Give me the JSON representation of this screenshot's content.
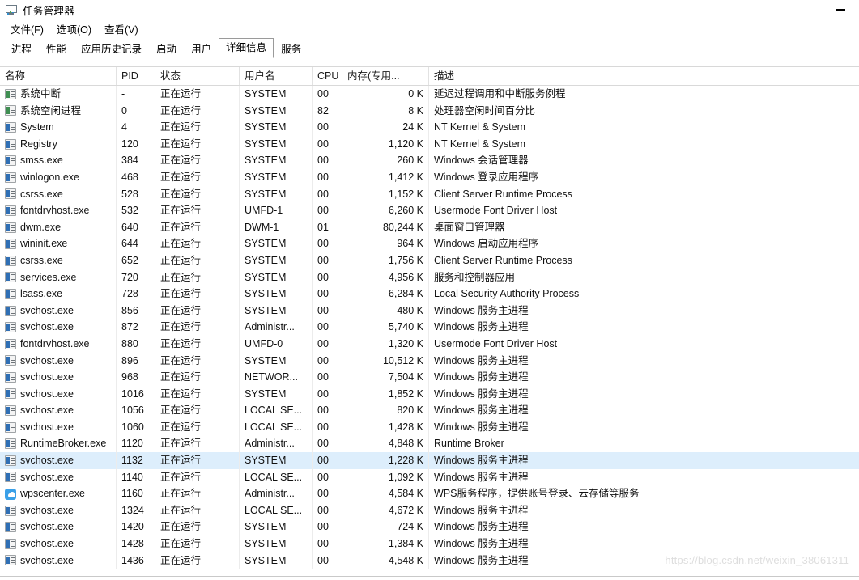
{
  "window": {
    "title": "任务管理器",
    "icon": "task-manager-icon",
    "controls": [
      {
        "name": "minimize-button",
        "glyph": "—"
      }
    ]
  },
  "menu": {
    "items": [
      {
        "label": "文件(F)",
        "accel": "F"
      },
      {
        "label": "选项(O)",
        "accel": "O"
      },
      {
        "label": "查看(V)",
        "accel": "V"
      }
    ]
  },
  "tabs": {
    "active": "详细信息",
    "items": [
      {
        "label": "进程"
      },
      {
        "label": "性能"
      },
      {
        "label": "应用历史记录"
      },
      {
        "label": "启动"
      },
      {
        "label": "用户"
      },
      {
        "label": "详细信息"
      },
      {
        "label": "服务"
      }
    ]
  },
  "table": {
    "sort": {
      "column": "PID",
      "direction": "asc",
      "marker": "⌃"
    },
    "columns": [
      {
        "key": "name",
        "label": "名称",
        "align": "left"
      },
      {
        "key": "pid",
        "label": "PID",
        "align": "left"
      },
      {
        "key": "status",
        "label": "状态",
        "align": "left"
      },
      {
        "key": "user",
        "label": "用户名",
        "align": "left"
      },
      {
        "key": "cpu",
        "label": "CPU",
        "align": "left"
      },
      {
        "key": "memory",
        "label": "内存(专用...",
        "align": "right"
      },
      {
        "key": "description",
        "label": "描述",
        "align": "left"
      }
    ],
    "selected_index": 22,
    "rows": [
      {
        "icon": "system-process-icon",
        "name": "系统中断",
        "pid": "-",
        "status": "正在运行",
        "user": "SYSTEM",
        "cpu": "00",
        "memory": "0 K",
        "description": "延迟过程调用和中断服务例程"
      },
      {
        "icon": "system-process-icon",
        "name": "系统空闲进程",
        "pid": "0",
        "status": "正在运行",
        "user": "SYSTEM",
        "cpu": "82",
        "memory": "8 K",
        "description": "处理器空闲时间百分比"
      },
      {
        "icon": "exe-icon",
        "name": "System",
        "pid": "4",
        "status": "正在运行",
        "user": "SYSTEM",
        "cpu": "00",
        "memory": "24 K",
        "description": "NT Kernel & System"
      },
      {
        "icon": "exe-icon",
        "name": "Registry",
        "pid": "120",
        "status": "正在运行",
        "user": "SYSTEM",
        "cpu": "00",
        "memory": "1,120 K",
        "description": "NT Kernel & System"
      },
      {
        "icon": "exe-icon",
        "name": "smss.exe",
        "pid": "384",
        "status": "正在运行",
        "user": "SYSTEM",
        "cpu": "00",
        "memory": "260 K",
        "description": "Windows 会话管理器"
      },
      {
        "icon": "exe-icon",
        "name": "winlogon.exe",
        "pid": "468",
        "status": "正在运行",
        "user": "SYSTEM",
        "cpu": "00",
        "memory": "1,412 K",
        "description": "Windows 登录应用程序"
      },
      {
        "icon": "exe-icon",
        "name": "csrss.exe",
        "pid": "528",
        "status": "正在运行",
        "user": "SYSTEM",
        "cpu": "00",
        "memory": "1,152 K",
        "description": "Client Server Runtime Process"
      },
      {
        "icon": "exe-icon",
        "name": "fontdrvhost.exe",
        "pid": "532",
        "status": "正在运行",
        "user": "UMFD-1",
        "cpu": "00",
        "memory": "6,260 K",
        "description": "Usermode Font Driver Host"
      },
      {
        "icon": "exe-icon",
        "name": "dwm.exe",
        "pid": "640",
        "status": "正在运行",
        "user": "DWM-1",
        "cpu": "01",
        "memory": "80,244 K",
        "description": "桌面窗口管理器"
      },
      {
        "icon": "exe-icon",
        "name": "wininit.exe",
        "pid": "644",
        "status": "正在运行",
        "user": "SYSTEM",
        "cpu": "00",
        "memory": "964 K",
        "description": "Windows 启动应用程序"
      },
      {
        "icon": "exe-icon",
        "name": "csrss.exe",
        "pid": "652",
        "status": "正在运行",
        "user": "SYSTEM",
        "cpu": "00",
        "memory": "1,756 K",
        "description": "Client Server Runtime Process"
      },
      {
        "icon": "exe-icon",
        "name": "services.exe",
        "pid": "720",
        "status": "正在运行",
        "user": "SYSTEM",
        "cpu": "00",
        "memory": "4,956 K",
        "description": "服务和控制器应用"
      },
      {
        "icon": "exe-icon",
        "name": "lsass.exe",
        "pid": "728",
        "status": "正在运行",
        "user": "SYSTEM",
        "cpu": "00",
        "memory": "6,284 K",
        "description": "Local Security Authority Process"
      },
      {
        "icon": "exe-icon",
        "name": "svchost.exe",
        "pid": "856",
        "status": "正在运行",
        "user": "SYSTEM",
        "cpu": "00",
        "memory": "480 K",
        "description": "Windows 服务主进程"
      },
      {
        "icon": "exe-icon",
        "name": "svchost.exe",
        "pid": "872",
        "status": "正在运行",
        "user": "Administr...",
        "cpu": "00",
        "memory": "5,740 K",
        "description": "Windows 服务主进程"
      },
      {
        "icon": "exe-icon",
        "name": "fontdrvhost.exe",
        "pid": "880",
        "status": "正在运行",
        "user": "UMFD-0",
        "cpu": "00",
        "memory": "1,320 K",
        "description": "Usermode Font Driver Host"
      },
      {
        "icon": "exe-icon",
        "name": "svchost.exe",
        "pid": "896",
        "status": "正在运行",
        "user": "SYSTEM",
        "cpu": "00",
        "memory": "10,512 K",
        "description": "Windows 服务主进程"
      },
      {
        "icon": "exe-icon",
        "name": "svchost.exe",
        "pid": "968",
        "status": "正在运行",
        "user": "NETWOR...",
        "cpu": "00",
        "memory": "7,504 K",
        "description": "Windows 服务主进程"
      },
      {
        "icon": "exe-icon",
        "name": "svchost.exe",
        "pid": "1016",
        "status": "正在运行",
        "user": "SYSTEM",
        "cpu": "00",
        "memory": "1,852 K",
        "description": "Windows 服务主进程"
      },
      {
        "icon": "exe-icon",
        "name": "svchost.exe",
        "pid": "1056",
        "status": "正在运行",
        "user": "LOCAL SE...",
        "cpu": "00",
        "memory": "820 K",
        "description": "Windows 服务主进程"
      },
      {
        "icon": "exe-icon",
        "name": "svchost.exe",
        "pid": "1060",
        "status": "正在运行",
        "user": "LOCAL SE...",
        "cpu": "00",
        "memory": "1,428 K",
        "description": "Windows 服务主进程"
      },
      {
        "icon": "exe-icon",
        "name": "RuntimeBroker.exe",
        "pid": "1120",
        "status": "正在运行",
        "user": "Administr...",
        "cpu": "00",
        "memory": "4,848 K",
        "description": "Runtime Broker"
      },
      {
        "icon": "exe-icon",
        "name": "svchost.exe",
        "pid": "1132",
        "status": "正在运行",
        "user": "SYSTEM",
        "cpu": "00",
        "memory": "1,228 K",
        "description": "Windows 服务主进程"
      },
      {
        "icon": "exe-icon",
        "name": "svchost.exe",
        "pid": "1140",
        "status": "正在运行",
        "user": "LOCAL SE...",
        "cpu": "00",
        "memory": "1,092 K",
        "description": "Windows 服务主进程"
      },
      {
        "icon": "wps-cloud-icon",
        "name": "wpscenter.exe",
        "pid": "1160",
        "status": "正在运行",
        "user": "Administr...",
        "cpu": "00",
        "memory": "4,584 K",
        "description": "WPS服务程序，提供账号登录、云存储等服务"
      },
      {
        "icon": "exe-icon",
        "name": "svchost.exe",
        "pid": "1324",
        "status": "正在运行",
        "user": "LOCAL SE...",
        "cpu": "00",
        "memory": "4,672 K",
        "description": "Windows 服务主进程"
      },
      {
        "icon": "exe-icon",
        "name": "svchost.exe",
        "pid": "1420",
        "status": "正在运行",
        "user": "SYSTEM",
        "cpu": "00",
        "memory": "724 K",
        "description": "Windows 服务主进程"
      },
      {
        "icon": "exe-icon",
        "name": "svchost.exe",
        "pid": "1428",
        "status": "正在运行",
        "user": "SYSTEM",
        "cpu": "00",
        "memory": "1,384 K",
        "description": "Windows 服务主进程"
      },
      {
        "icon": "exe-icon",
        "name": "svchost.exe",
        "pid": "1436",
        "status": "正在运行",
        "user": "SYSTEM",
        "cpu": "00",
        "memory": "4,548 K",
        "description": "Windows 服务主进程"
      }
    ]
  },
  "watermark": {
    "text": "https://blog.csdn.net/weixin_38061311"
  },
  "colors": {
    "selection": "#ddeefc",
    "accent": "#2f6fb5",
    "system_icon": "#3f8f52",
    "wps_blue": "#3aa0e8",
    "watermark": "#dedede"
  }
}
